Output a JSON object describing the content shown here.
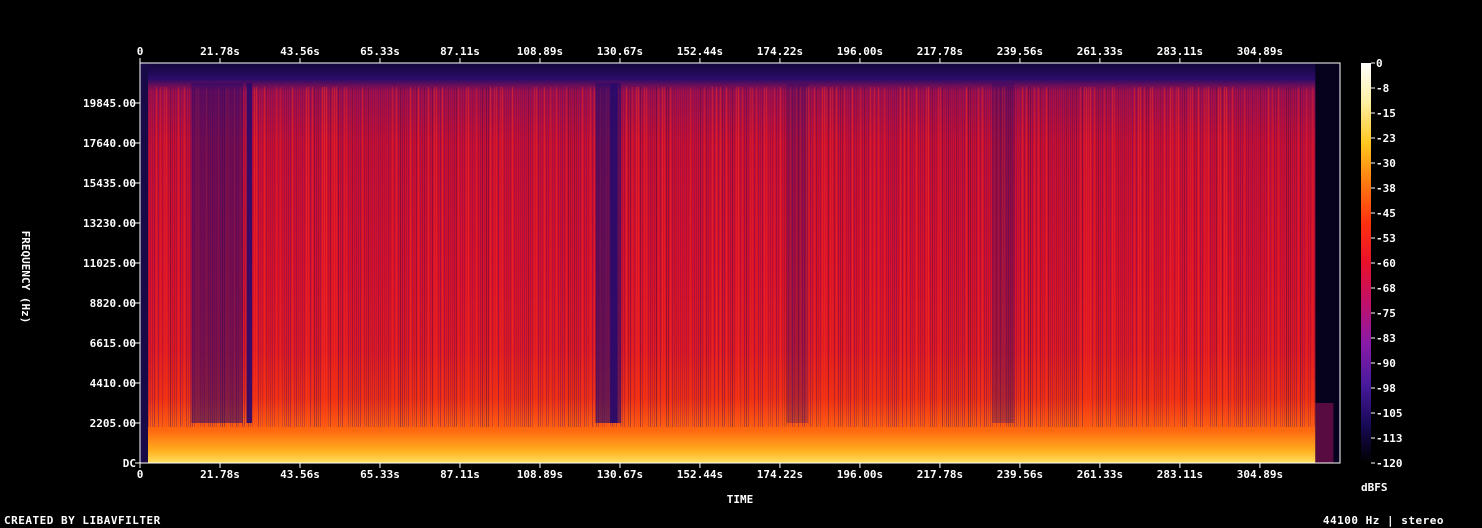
{
  "chart_data": {
    "type": "heatmap",
    "title": "",
    "xlabel": "TIME",
    "ylabel": "FREQUENCY (Hz)",
    "x_ticks": [
      "0",
      "21.78s",
      "43.56s",
      "65.33s",
      "87.11s",
      "108.89s",
      "130.67s",
      "152.44s",
      "174.22s",
      "196.00s",
      "217.78s",
      "239.56s",
      "261.33s",
      "283.11s",
      "304.89s"
    ],
    "x_tick_values": [
      0,
      21.78,
      43.56,
      65.33,
      87.11,
      108.89,
      130.67,
      152.44,
      174.22,
      196.0,
      217.78,
      239.56,
      261.33,
      283.11,
      304.89
    ],
    "xlim": [
      0,
      326.7
    ],
    "y_ticks": [
      "DC",
      "2205.00",
      "4410.00",
      "6615.00",
      "8820.00",
      "11025.00",
      "13230.00",
      "15435.00",
      "17640.00",
      "19845.00"
    ],
    "y_tick_values": [
      0,
      2205,
      4410,
      6615,
      8820,
      11025,
      13230,
      15435,
      17640,
      19845
    ],
    "ylim": [
      0,
      22050
    ],
    "colorbar": {
      "label": "dBFS",
      "ticks": [
        "0",
        "-8",
        "-15",
        "-23",
        "-30",
        "-38",
        "-45",
        "-53",
        "-60",
        "-68",
        "-75",
        "-83",
        "-90",
        "-98",
        "-105",
        "-113",
        "-120"
      ],
      "range": [
        -120,
        0
      ],
      "colors": [
        "#000000",
        "#1a0a5a",
        "#4a1a9e",
        "#8a1aa8",
        "#c0106a",
        "#e8102a",
        "#ff3010",
        "#ff7a10",
        "#ffc820",
        "#fff0a0",
        "#ffffff"
      ]
    },
    "duration_seconds": 320,
    "sample_rate_hz": 44100
  },
  "footer": {
    "left": "CREATED BY LIBAVFILTER",
    "right": "44100 Hz | stereo"
  }
}
